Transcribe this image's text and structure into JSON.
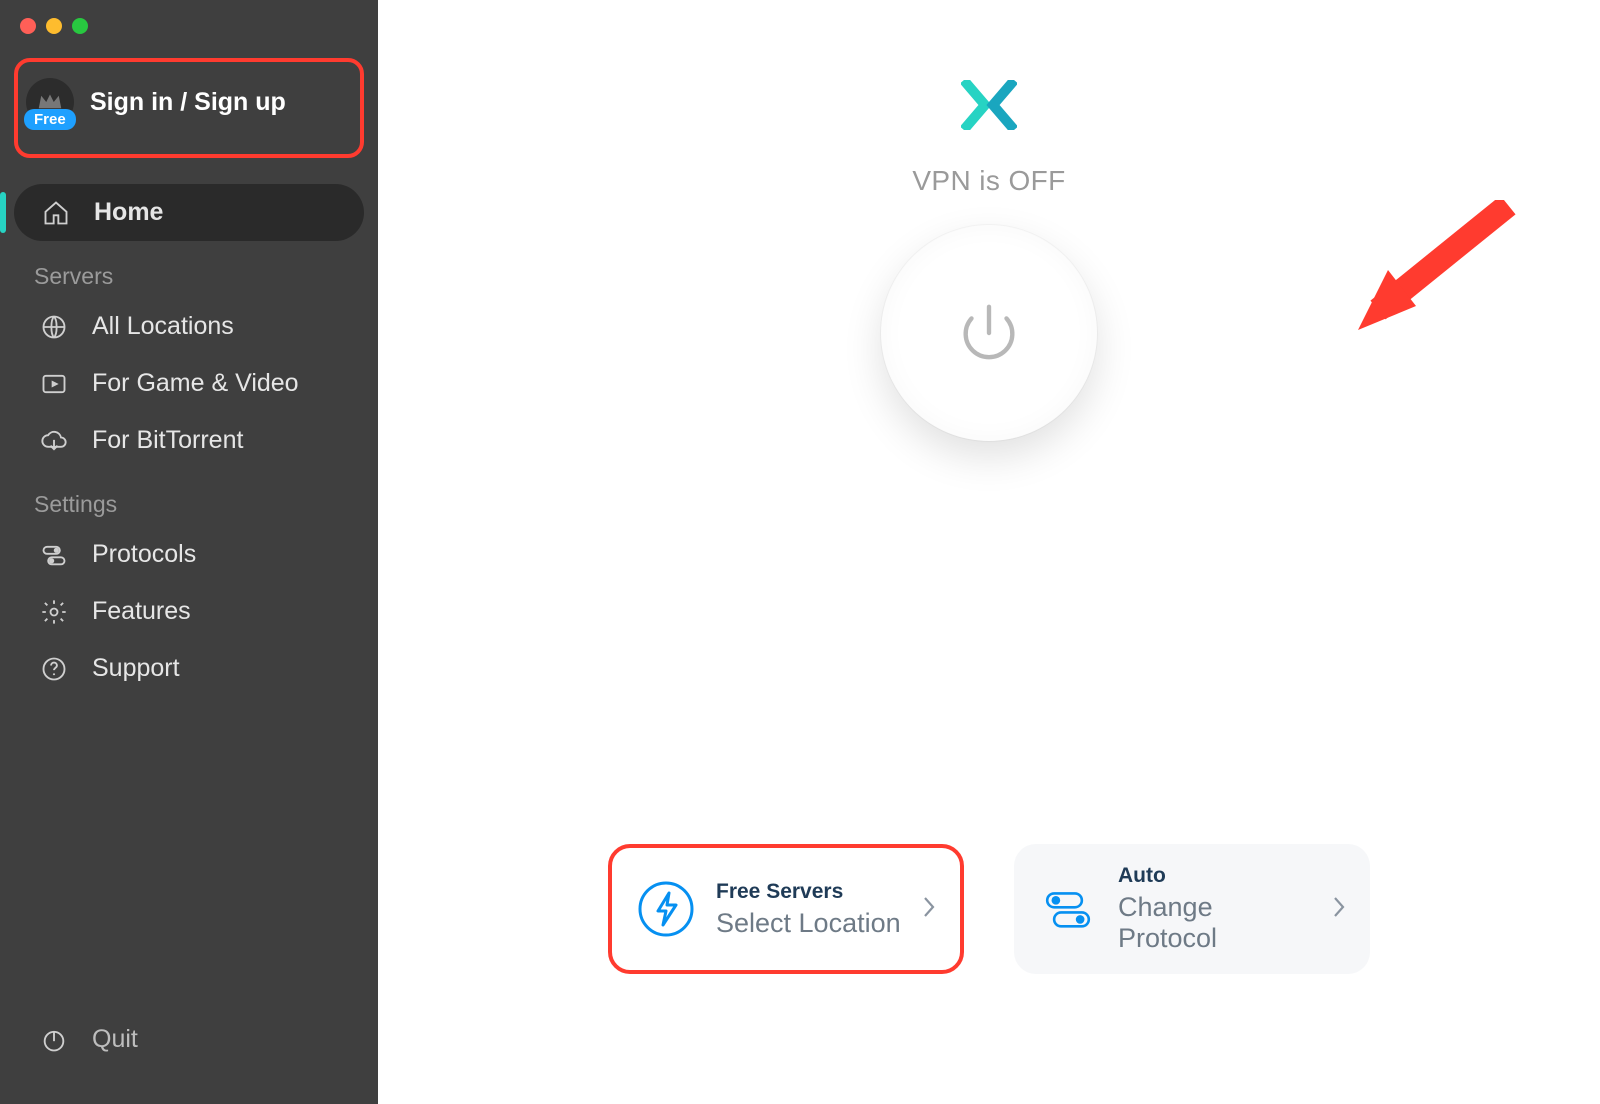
{
  "account": {
    "sign_in_label": "Sign in / Sign up",
    "badge": "Free"
  },
  "sidebar": {
    "home": "Home",
    "section_servers": "Servers",
    "section_settings": "Settings",
    "items_servers": [
      {
        "label": "All Locations",
        "icon": "globe-icon"
      },
      {
        "label": "For Game & Video",
        "icon": "play-icon"
      },
      {
        "label": "For BitTorrent",
        "icon": "cloud-download-icon"
      }
    ],
    "items_settings": [
      {
        "label": "Protocols",
        "icon": "toggles-icon"
      },
      {
        "label": "Features",
        "icon": "gear-icon"
      },
      {
        "label": "Support",
        "icon": "help-icon"
      }
    ],
    "quit": "Quit"
  },
  "main": {
    "status": "VPN is OFF",
    "server_card": {
      "small": "Free Servers",
      "big": "Select Location"
    },
    "protocol_card": {
      "small": "Auto",
      "big": "Change Protocol"
    }
  },
  "colors": {
    "accent_teal": "#27d3c3",
    "accent_blue": "#0690f1",
    "highlight_red": "#ff3b2f"
  }
}
